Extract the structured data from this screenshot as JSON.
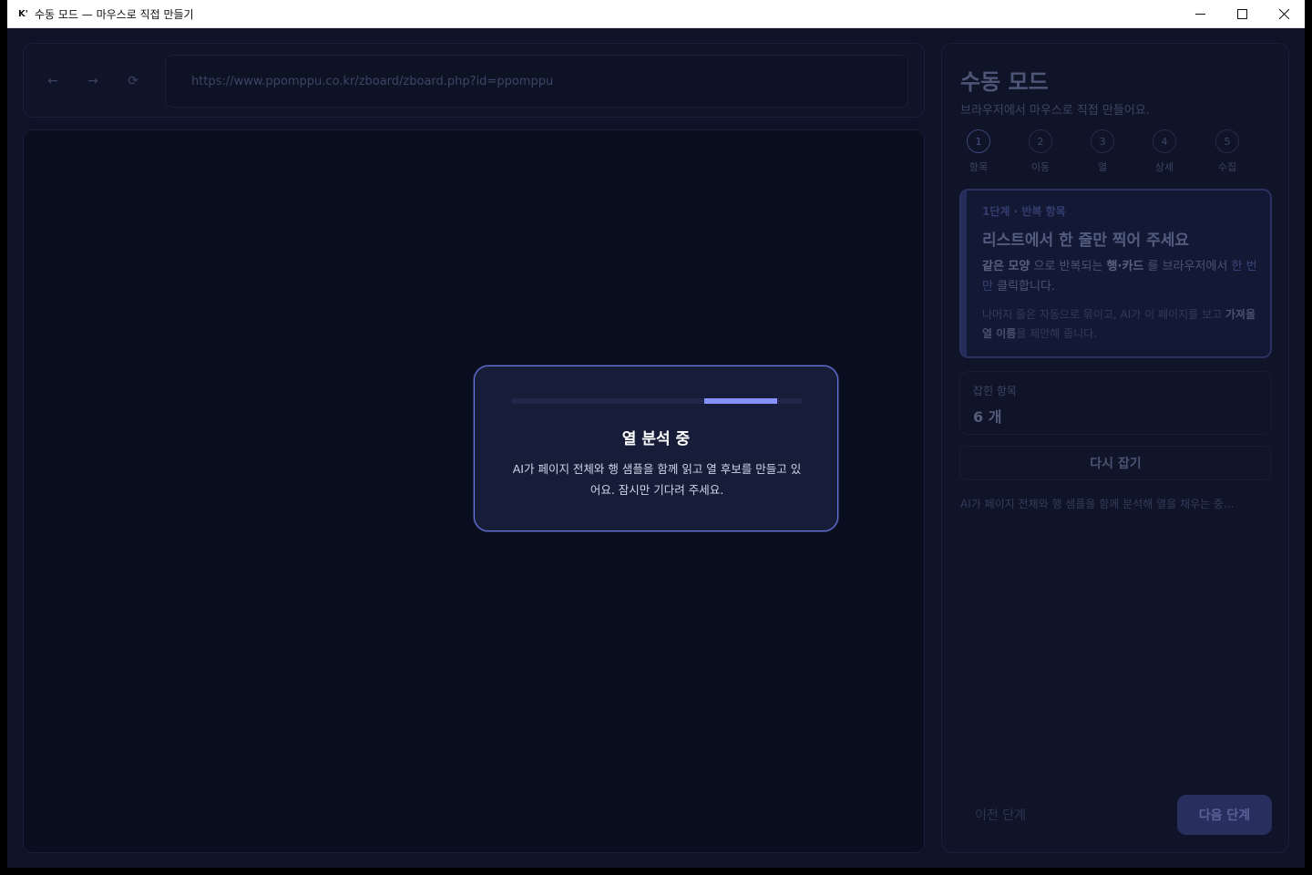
{
  "window": {
    "icon_text": "K'",
    "title": "수동 모드 — 마우스로 직접 만들기"
  },
  "browser": {
    "back_label": "←",
    "forward_label": "→",
    "reload_label": "⟳",
    "url": "https://www.ppomppu.co.kr/zboard/zboard.php?id=ppomppu"
  },
  "panel": {
    "title": "수동 모드",
    "subtitle": "브라우저에서 마우스로 직접 만들어요.",
    "steps": [
      {
        "number": "1",
        "label": "항목"
      },
      {
        "number": "2",
        "label": "이동"
      },
      {
        "number": "3",
        "label": "열"
      },
      {
        "number": "4",
        "label": "상세"
      },
      {
        "number": "5",
        "label": "수집"
      }
    ],
    "card": {
      "kicker": "1단계 · 반복 항목",
      "title": "리스트에서 한 줄만 찍어 주세요",
      "desc_part1": "같은 모양",
      "desc_part2": " 으로 반복되는 ",
      "desc_part3": "행·카드",
      "desc_part4": " 를 브라우저에서 ",
      "desc_part5": "한 번만",
      "desc_part6": " 클릭합니다.",
      "note_part1": "나머지 줄은 자동으로 묶이고, AI가 이 페이지를 보고 ",
      "note_part2": "가져올 열 이름",
      "note_part3": "을 제안해 줍니다."
    },
    "count_label": "잡힌 항목",
    "count_value": "6 개",
    "recapture_label": "다시 잡기",
    "status": "AI가 페이지 전체와 행 샘플을 함께 분석해 열을 채우는 중...",
    "prev_label": "이전 단계",
    "next_label": "다음 단계"
  },
  "modal": {
    "title": "열 분석 중",
    "description": "AI가 페이지 전체와 행 샘플을 함께 읽고 열 후보를 만들고 있어요. 잠시만 기다려 주세요.",
    "progress_color": "#8790ff"
  },
  "colors": {
    "accent": "#6d78e6",
    "background": "#0e1327"
  }
}
